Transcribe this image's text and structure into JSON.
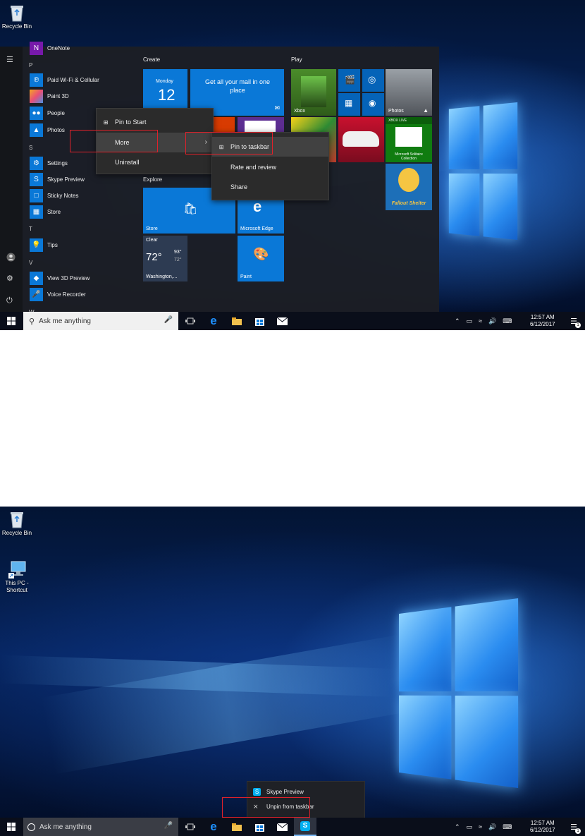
{
  "shot1": {
    "desktop_icons": [
      {
        "label": "Recycle Bin",
        "icon": "recycle-bin-icon"
      }
    ],
    "rail_icons": [
      "hamburger-menu-icon",
      "user-avatar-icon",
      "settings-gear-icon",
      "power-icon"
    ],
    "app_list": [
      {
        "type": "app",
        "label": "OneNote",
        "color": "#7719aa",
        "icon": "onenote-icon"
      },
      {
        "type": "letter",
        "label": "P"
      },
      {
        "type": "app",
        "label": "Paid Wi-Fi & Cellular",
        "color": "#0a78d7",
        "icon": "wifi-cellular-icon"
      },
      {
        "type": "app",
        "label": "Paint 3D",
        "color": "#0a78d7",
        "icon": "paint-3d-icon"
      },
      {
        "type": "app",
        "label": "People",
        "color": "#0a78d7",
        "icon": "people-icon"
      },
      {
        "type": "app",
        "label": "Photos",
        "color": "#0a78d7",
        "icon": "photos-icon"
      },
      {
        "type": "letter",
        "label": "S"
      },
      {
        "type": "app",
        "label": "Settings",
        "color": "#0a78d7",
        "icon": "settings-icon"
      },
      {
        "type": "app",
        "label": "Skype Preview",
        "color": "#0a78d7",
        "icon": "skype-icon"
      },
      {
        "type": "app",
        "label": "Sticky Notes",
        "color": "#0a78d7",
        "icon": "sticky-notes-icon"
      },
      {
        "type": "app",
        "label": "Store",
        "color": "#0a78d7",
        "icon": "store-icon"
      },
      {
        "type": "letter",
        "label": "T"
      },
      {
        "type": "app",
        "label": "Tips",
        "color": "#0a78d7",
        "icon": "tips-icon"
      },
      {
        "type": "letter",
        "label": "V"
      },
      {
        "type": "app",
        "label": "View 3D Preview",
        "color": "#0a78d7",
        "icon": "view-3d-icon"
      },
      {
        "type": "app",
        "label": "Voice Recorder",
        "color": "#0a78d7",
        "icon": "voice-recorder-icon"
      },
      {
        "type": "letter",
        "label": "W"
      }
    ],
    "groups": {
      "create": "Create",
      "play": "Play",
      "explore": "Explore"
    },
    "tiles": {
      "calendar": {
        "day": "Monday",
        "date": "12"
      },
      "mail": {
        "text": "Get all your mail in one place"
      },
      "xbox": "Xbox",
      "photos": "Photos",
      "solitaire": {
        "badge": "XBOX LIVE",
        "label": "Microsoft Solitaire Collection"
      },
      "fallout": "Fallout Shelter",
      "store": "Store",
      "edge": "Microsoft Edge",
      "weather": {
        "cond": "Clear",
        "temp": "72°",
        "hi": "93°",
        "lo": "72°",
        "city": "Washington,..."
      },
      "paint": "Paint"
    },
    "context_menu": {
      "pin_to_start": "Pin to Start",
      "more": "More",
      "uninstall": "Uninstall"
    },
    "submenu": {
      "pin_to_taskbar": "Pin to taskbar",
      "rate_review": "Rate and review",
      "share": "Share"
    }
  },
  "shot2": {
    "desktop_icons": [
      {
        "label": "Recycle Bin",
        "icon": "recycle-bin-icon"
      },
      {
        "label": "This PC - Shortcut",
        "icon": "this-pc-icon"
      }
    ],
    "jump_list": {
      "app": "Skype Preview",
      "unpin": "Unpin from taskbar"
    }
  },
  "taskbar": {
    "search_placeholder": "Ask me anything",
    "time": "12:57 AM",
    "date": "6/12/2017",
    "notification_count": "1",
    "apps": [
      "task-view-icon",
      "edge-icon",
      "file-explorer-icon",
      "store-icon",
      "mail-icon"
    ]
  },
  "colors": {
    "accent": "#0a78d7",
    "highlight_box": "#e0212a",
    "taskbar": "#0a0e1a"
  }
}
